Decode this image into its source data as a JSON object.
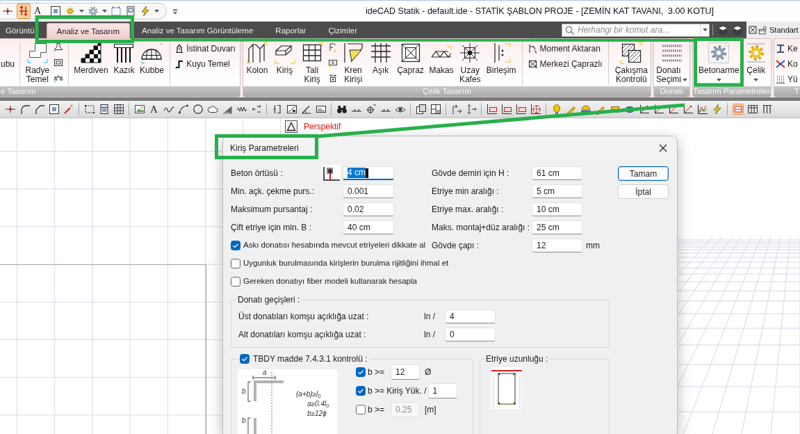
{
  "window": {
    "title": "ideCAD Statik - default.ide - STATİK ŞABLON PROJE - [ZEMİN KAT TAVANI,  3.00 KOTU]"
  },
  "quick_access": {
    "glyph": "A"
  },
  "tabs": [
    {
      "label": "Görüntü",
      "selected": false
    },
    {
      "label": "Analiz ve Tasarım",
      "selected": true
    },
    {
      "label": "Analiz ve Tasarım Görüntüleme",
      "selected": false
    },
    {
      "label": "Raporlar",
      "selected": false
    },
    {
      "label": "Çizimler",
      "selected": false
    }
  ],
  "search": {
    "placeholder": "Herhangi bir komut ara..."
  },
  "workspace": {
    "label": "Standart"
  },
  "ribbon": {
    "groups": [
      {
        "label": "e Tasarım",
        "items": [
          {
            "kind": "cut_label",
            "label": "ubu"
          },
          {
            "kind": "separator"
          },
          {
            "kind": "large",
            "label": "Radye Temel"
          },
          {
            "kind": "icon_column"
          },
          {
            "kind": "separator"
          },
          {
            "kind": "large",
            "label": "Merdiven"
          },
          {
            "kind": "large",
            "label": "Kazık"
          },
          {
            "kind": "large",
            "label": "Kubbe"
          },
          {
            "kind": "separator"
          },
          {
            "kind": "small_stack",
            "labels": [
              "İstinat Duvarı",
              "Kuyu Temel"
            ]
          }
        ]
      },
      {
        "label": "Çelik Tasarım",
        "items": [
          {
            "kind": "large",
            "label": "Kolon"
          },
          {
            "kind": "large",
            "label": "Kiriş"
          },
          {
            "kind": "large",
            "label": "Tali Kiriş"
          },
          {
            "kind": "icon_column"
          },
          {
            "kind": "large",
            "label": "Kren Kirişi"
          },
          {
            "kind": "large",
            "label": "Aşık"
          },
          {
            "kind": "large",
            "label": "Çapraz"
          },
          {
            "kind": "large",
            "label": "Makas"
          },
          {
            "kind": "large",
            "label": "Uzay Kafes"
          },
          {
            "kind": "large",
            "label": "Birleşim"
          },
          {
            "kind": "separator"
          },
          {
            "kind": "small_stack",
            "labels": [
              "Moment Aktaran",
              "Merkezi Çaprazlı"
            ]
          },
          {
            "kind": "separator"
          },
          {
            "kind": "large",
            "label": "Çakışma Kontrolü"
          }
        ]
      },
      {
        "label": "Donatı",
        "items": [
          {
            "kind": "large_split",
            "label": "Donatı Seçimi"
          }
        ]
      },
      {
        "label": "Tasarım Parametreleri",
        "items": [
          {
            "kind": "large_dropdown",
            "label": "Betonarme"
          },
          {
            "kind": "large_dropdown",
            "label": "Çelik"
          }
        ]
      },
      {
        "label": "T",
        "items": [
          {
            "kind": "small_stack",
            "labels": [
              "Ke",
              "Ko",
              "Yü"
            ]
          }
        ]
      }
    ]
  },
  "toolbar": {
    "text_glyph": "A"
  },
  "viewport": {
    "label": "Perspektif"
  },
  "dialog": {
    "title": "Kiriş Parametreleri",
    "fields_left": [
      {
        "label": "Beton örtüsü :",
        "value": "4 cm",
        "focused": true
      },
      {
        "label": "Min. açk. çekme purs.:",
        "value": "0.001",
        "focused": false
      },
      {
        "label": "Maksimum pursantaj :",
        "value": "0.02",
        "focused": false
      },
      {
        "label": "Çift etriye için min. B :",
        "value": "40 cm",
        "focused": false
      }
    ],
    "fields_right": [
      {
        "label": "Gövde demiri için H :",
        "value": "61 cm",
        "focused": false
      },
      {
        "label": "Etriye min aralığı :",
        "value": "5 cm",
        "focused": false
      },
      {
        "label": "Etriye max. aralığı :",
        "value": "10 cm",
        "focused": false
      },
      {
        "label": "Maks. montaj+düz aralığı :",
        "value": "25 cm",
        "focused": false
      },
      {
        "label": "Gövde çapı :",
        "value": "12",
        "unit": "mm",
        "focused": false
      }
    ],
    "options": [
      {
        "label": "Askı donatısı hesabında mevcut etriyeleri dikkate al",
        "checked": true
      },
      {
        "label": "Uygunluk burulmasında kirişlerin burulma rijitliğini ihmal et",
        "checked": false
      },
      {
        "label": "Gereken donatıyı fiber modeli kullanarak hesapla",
        "checked": false
      }
    ],
    "buttons": [
      {
        "label": "Tamam",
        "default": true
      },
      {
        "label": "İptal",
        "default": false
      }
    ],
    "transitions": {
      "title": "Donatı geçişleri :",
      "rows": [
        {
          "label": "Üst donatıları komşu açıklığa uzat :",
          "prefix": "ln /",
          "value": "4"
        },
        {
          "label": "Alt donatıları komşu açıklığa uzat :",
          "prefix": "ln /",
          "value": "0"
        }
      ]
    },
    "tbdy": {
      "label": "TBDY madde 7.4.3.1 kontrolü :",
      "checked": true,
      "diagram": {
        "dimension_labels": [
          "a",
          "b",
          "b"
        ],
        "formulas": [
          "(a+b)≥l$_{0}$",
          "a≥0.4l$_{0}$",
          "b≥12ϕ"
        ]
      },
      "rules": [
        {
          "label": "b >=",
          "checked": true,
          "value": "12",
          "unit": "Ø",
          "disabled": false
        },
        {
          "label": "b >= Kiriş Yük. /",
          "checked": true,
          "value": "1",
          "disabled": false
        },
        {
          "label": "b >=",
          "checked": false,
          "value": "0.25",
          "unit": "[m]",
          "disabled": true
        }
      ]
    },
    "stirrup_length": {
      "title": "Etriye uzunluğu :"
    }
  }
}
